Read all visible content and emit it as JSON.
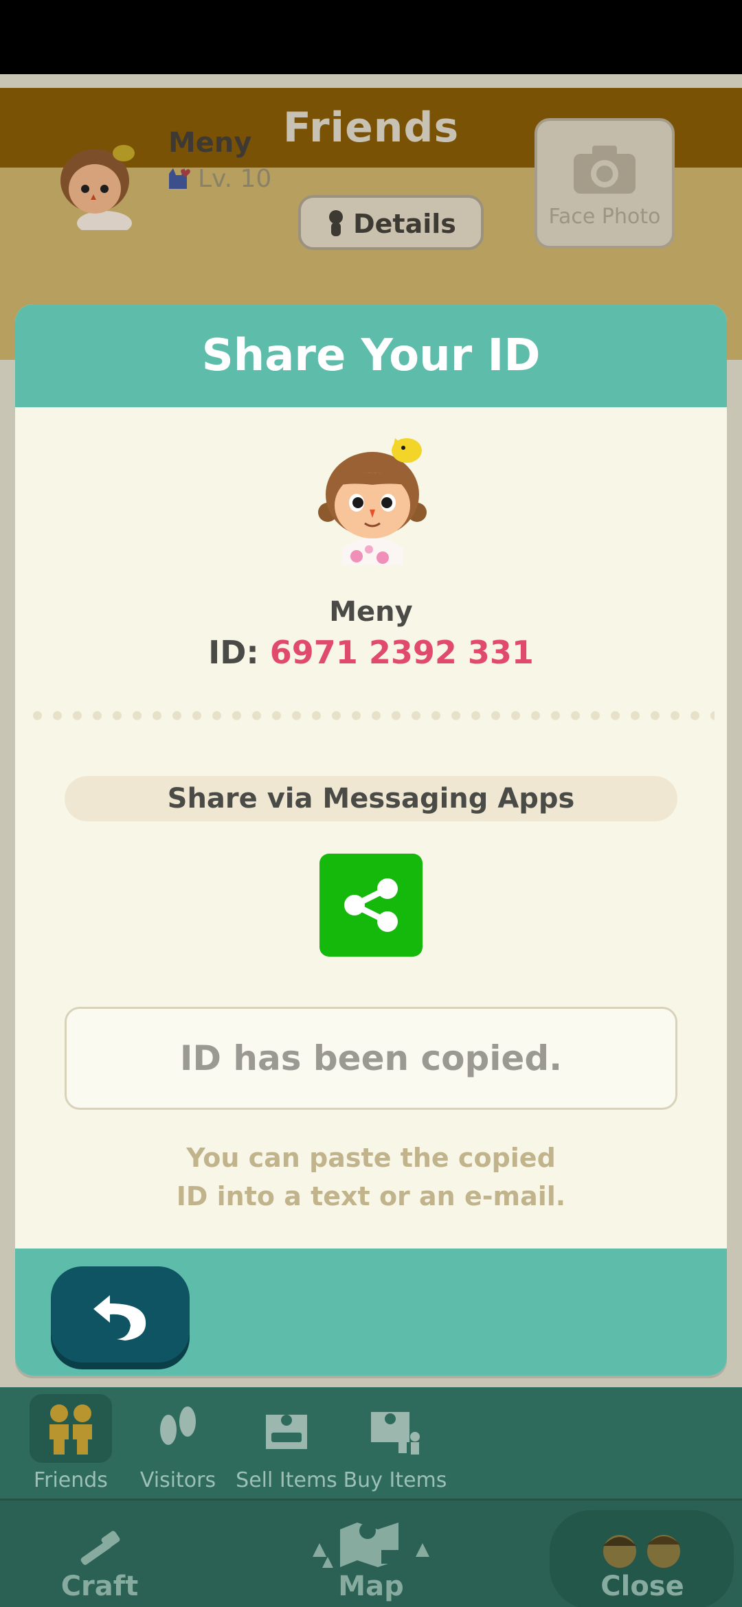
{
  "background": {
    "header_title": "Friends",
    "profile": {
      "name": "Meny",
      "level": "Lv. 10",
      "details_label": "Details",
      "photo_label": "Face Photo"
    }
  },
  "modal": {
    "title": "Share Your ID",
    "user_name": "Meny",
    "id_prefix": "ID: ",
    "id_value": "6971 2392 331",
    "share_label": "Share via Messaging Apps",
    "copied_text": "ID has been copied.",
    "hint_line1": "You can paste the copied",
    "hint_line2": "ID into a text or an e-mail."
  },
  "subnav": {
    "items": [
      {
        "label": "Friends",
        "icon": "friends-icon"
      },
      {
        "label": "Visitors",
        "icon": "footprints-icon"
      },
      {
        "label": "Sell Items",
        "icon": "sell-box-icon"
      },
      {
        "label": "Buy Items",
        "icon": "buy-box-icon"
      }
    ]
  },
  "mainnav": {
    "items": [
      {
        "label": "Craft",
        "icon": "craft-hammer-icon"
      },
      {
        "label": "Map",
        "icon": "map-icon"
      },
      {
        "label": "Close",
        "icon": "villagers-icon"
      }
    ]
  },
  "colors": {
    "header_teal": "#5dbdaa",
    "id_accent": "#e04b6b",
    "share_green": "#14b90c",
    "back_button": "#0e5462"
  }
}
